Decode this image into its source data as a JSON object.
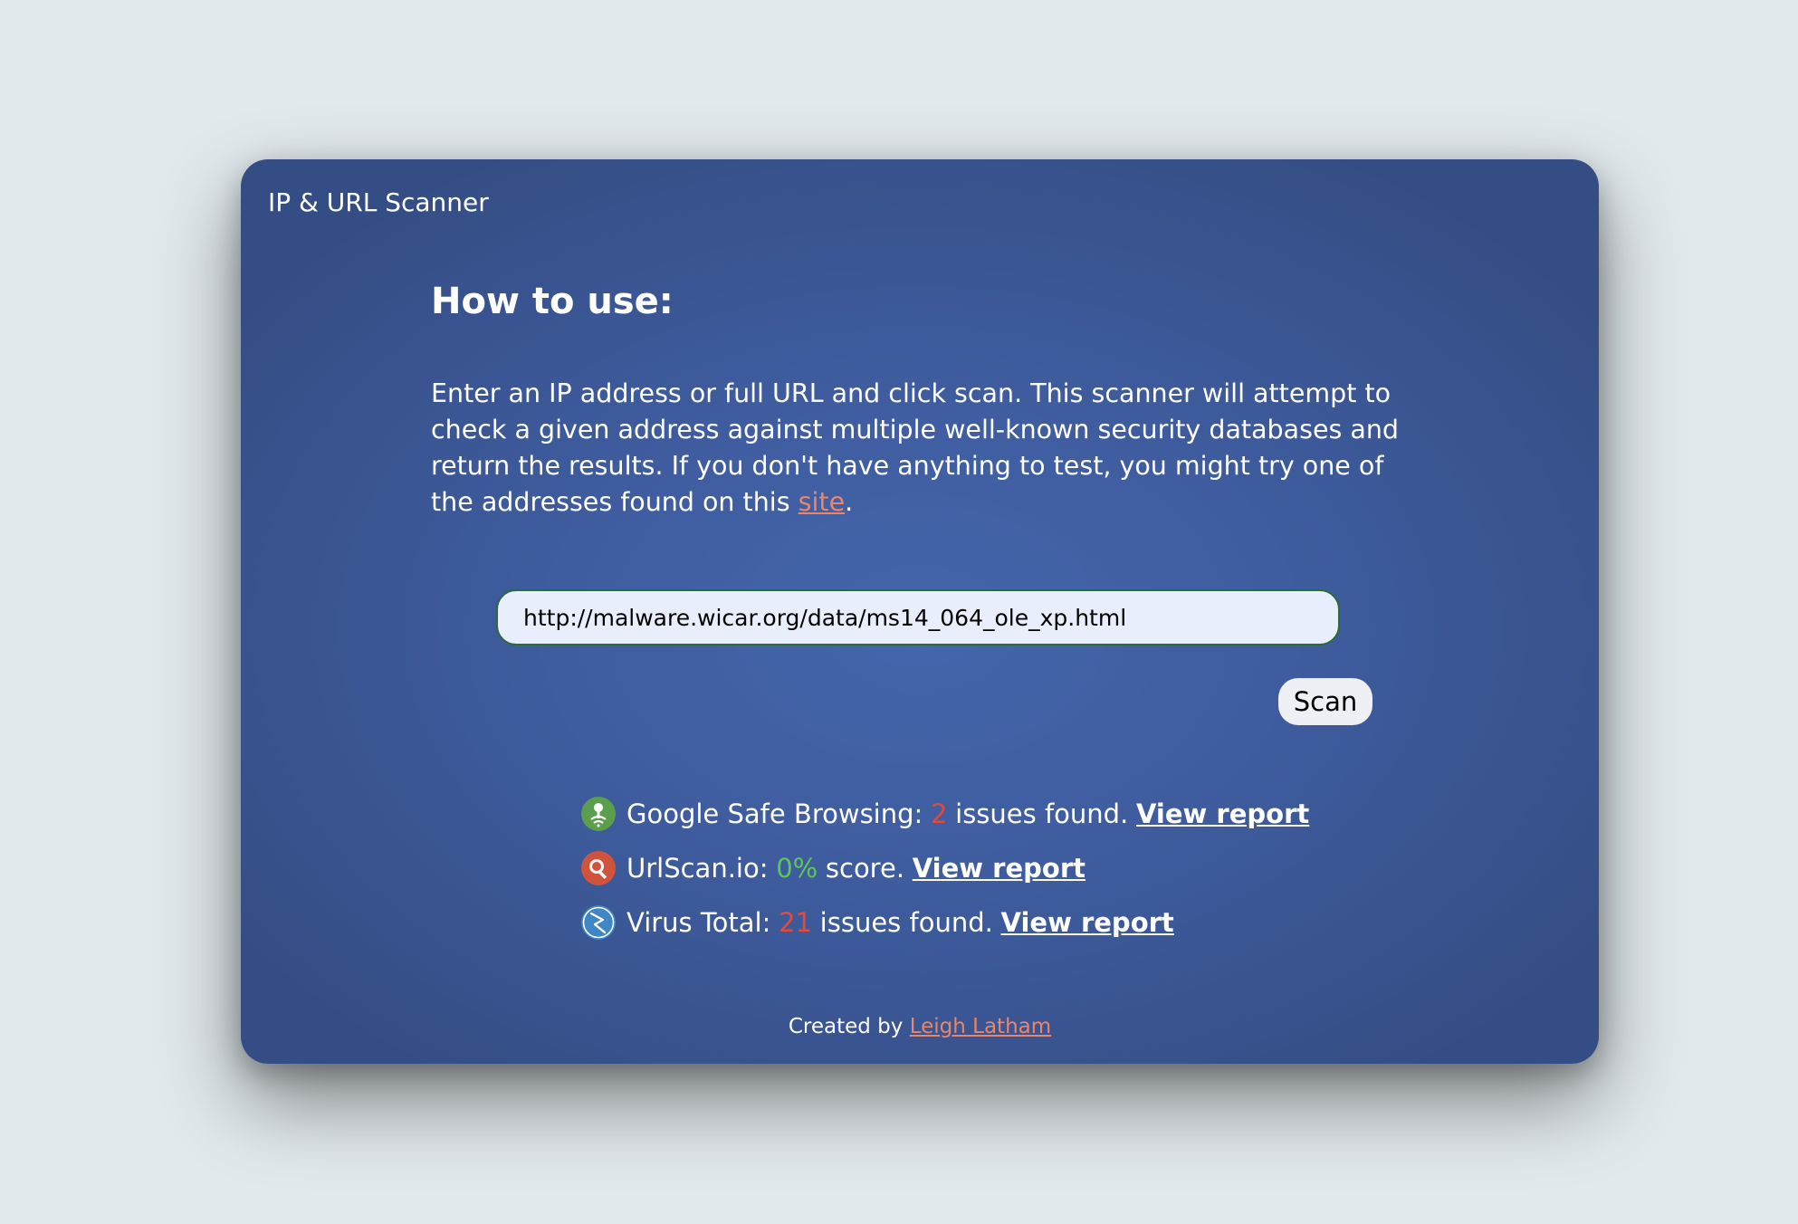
{
  "app": {
    "title": "IP & URL Scanner"
  },
  "instructions": {
    "heading": "How to use:",
    "text_before_link": "Enter an IP address or full URL and click scan. This scanner will attempt to check a given address against multiple well-known security databases and return the results. If you don't have anything to test, you might try one of the addresses found on this ",
    "link_label": "site",
    "text_after_link": "."
  },
  "search": {
    "value": "http://malware.wicar.org/data/ms14_064_ole_xp.html",
    "button_label": "Scan"
  },
  "results": [
    {
      "icon": "google-safe-browsing-icon",
      "service": "Google Safe Browsing:",
      "value": "2",
      "suffix": "issues found.",
      "link_label": "View report"
    },
    {
      "icon": "urlscan-icon",
      "service": "UrlScan.io:",
      "value": "0%",
      "suffix": "score.",
      "link_label": "View report"
    },
    {
      "icon": "virustotal-icon",
      "service": "Virus Total:",
      "value": "21",
      "suffix": "issues found.",
      "link_label": "View report"
    }
  ],
  "footer": {
    "prefix": "Created by ",
    "author_link": "Leigh Latham"
  },
  "colors": {
    "page_background": "#e1e9ec",
    "card_background": "#3d5a9b",
    "link_accent": "#e8866a",
    "bad_value": "#e04b3b",
    "good_value": "#5cc65a",
    "input_border": "#2d6a3a"
  }
}
